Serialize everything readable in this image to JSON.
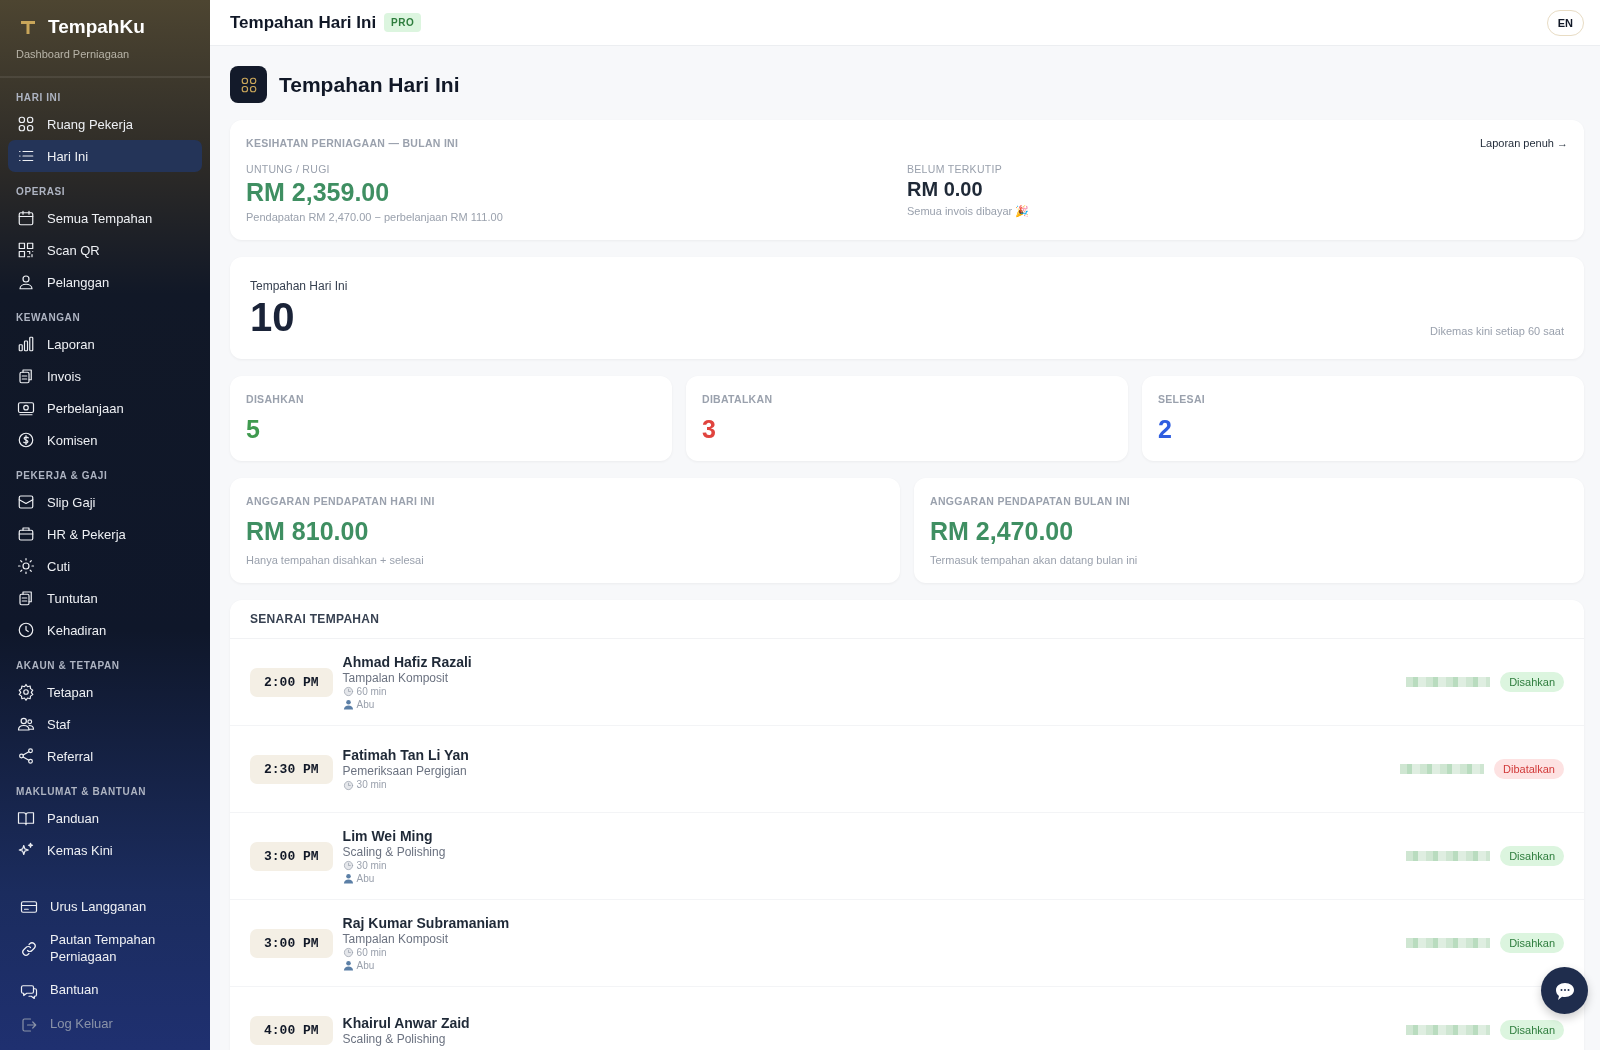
{
  "sidebar": {
    "brand": "TempahKu",
    "subtitle": "Dashboard Perniagaan",
    "sections": [
      {
        "label": "HARI INI",
        "items": [
          {
            "label": "Ruang Pekerja",
            "selected": false
          },
          {
            "label": "Hari Ini",
            "selected": true
          }
        ]
      },
      {
        "label": "OPERASI",
        "items": [
          {
            "label": "Semua Tempahan",
            "selected": false
          },
          {
            "label": "Scan QR",
            "selected": false
          },
          {
            "label": "Pelanggan",
            "selected": false
          }
        ]
      },
      {
        "label": "KEWANGAN",
        "items": [
          {
            "label": "Laporan",
            "selected": false
          },
          {
            "label": "Invois",
            "selected": false
          },
          {
            "label": "Perbelanjaan",
            "selected": false
          },
          {
            "label": "Komisen",
            "selected": false
          }
        ]
      },
      {
        "label": "PEKERJA & GAJI",
        "items": [
          {
            "label": "Slip Gaji",
            "selected": false
          },
          {
            "label": "HR & Pekerja",
            "selected": false
          },
          {
            "label": "Cuti",
            "selected": false
          },
          {
            "label": "Tuntutan",
            "selected": false
          },
          {
            "label": "Kehadiran",
            "selected": false
          }
        ]
      },
      {
        "label": "AKAUN & TETAPAN",
        "items": [
          {
            "label": "Tetapan",
            "selected": false
          },
          {
            "label": "Staf",
            "selected": false
          },
          {
            "label": "Referral",
            "selected": false
          }
        ]
      },
      {
        "label": "MAKLUMAT & BANTUAN",
        "items": [
          {
            "label": "Panduan",
            "selected": false
          },
          {
            "label": "Kemas Kini",
            "selected": false
          }
        ]
      }
    ],
    "footer_items": [
      {
        "label": "Urus Langganan",
        "kind": "link"
      },
      {
        "label": "Pautan Tempahan Perniagaan",
        "kind": "link"
      },
      {
        "label": "Bantuan",
        "kind": "link"
      },
      {
        "label": "Log Keluar",
        "kind": "logout"
      }
    ]
  },
  "topbar": {
    "title": "Tempahan Hari Ini",
    "badge": "PRO",
    "language": "EN"
  },
  "page_title": "Tempahan Hari Ini",
  "health": {
    "heading": "KESIHATAN PERNIAGAAN — BULAN INI",
    "link": "Laporan penuh →",
    "metrics": [
      {
        "label": "UNTUNG / RUGI",
        "value": "RM 2,359.00",
        "note": "Pendapatan RM 2,470.00 − perbelanjaan RM 111.00",
        "kind": "positive"
      },
      {
        "label": "BELUM TERKUTIP",
        "value": "RM 0.00",
        "note": "Semua invois dibayar 🎉",
        "kind": "neutral"
      }
    ]
  },
  "today": {
    "label": "Tempahan Hari Ini",
    "count": "10",
    "note": "Dikemas kini setiap 60 saat"
  },
  "status_counts": [
    {
      "label": "DISAHKAN",
      "value": "5",
      "color": "#3f9a4f"
    },
    {
      "label": "DIBATALKAN",
      "value": "3",
      "color": "#e0443e"
    },
    {
      "label": "SELESAI",
      "value": "2",
      "color": "#2f5ee0"
    }
  ],
  "revenue": [
    {
      "label": "ANGGARAN PENDAPATAN HARI INI",
      "value": "RM 810.00",
      "note": "Hanya tempahan disahkan + selesai"
    },
    {
      "label": "ANGGARAN PENDAPATAN BULAN INI",
      "value": "RM 2,470.00",
      "note": "Termasuk tempahan akan datang bulan ini"
    }
  ],
  "bookings": {
    "heading": "SENARAI TEMPAHAN",
    "rows": [
      {
        "time": "2:00 PM",
        "name": "Ahmad Hafiz Razali",
        "service": "Tampalan Komposit",
        "duration": "60 min",
        "staff": "Abu",
        "status": "Disahkan",
        "kind": "confirmed"
      },
      {
        "time": "2:30 PM",
        "name": "Fatimah Tan Li Yan",
        "service": "Pemeriksaan Pergigian",
        "duration": "30 min",
        "status": "Dibatalkan",
        "kind": "cancelled"
      },
      {
        "time": "3:00 PM",
        "name": "Lim Wei Ming",
        "service": "Scaling & Polishing",
        "duration": "30 min",
        "staff": "Abu",
        "status": "Disahkan",
        "kind": "confirmed"
      },
      {
        "time": "3:00 PM",
        "name": "Raj Kumar Subramaniam",
        "service": "Tampalan Komposit",
        "duration": "60 min",
        "staff": "Abu",
        "status": "Disahkan",
        "kind": "confirmed"
      },
      {
        "time": "4:00 PM",
        "name": "Khairul Anwar Zaid",
        "service": "Scaling & Polishing",
        "status": "Disahkan",
        "kind": "confirmed"
      }
    ]
  }
}
